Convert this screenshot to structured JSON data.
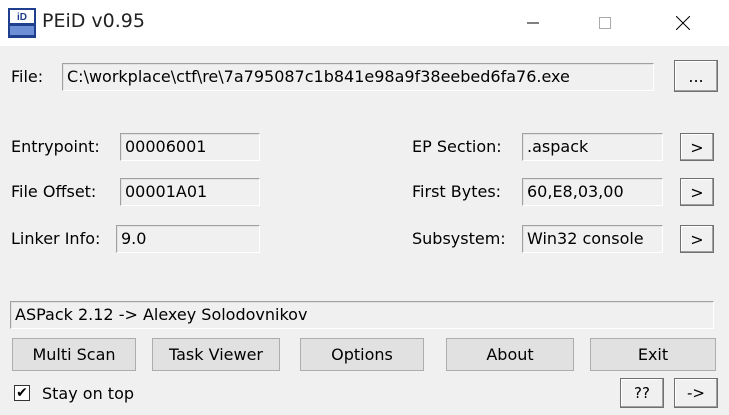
{
  "window": {
    "title": "PEiD v0.95",
    "icon": "peid-app-icon",
    "controls": {
      "minimize": "minimize-icon",
      "maximize": "maximize-icon",
      "close": "close-icon"
    }
  },
  "file": {
    "label": "File:",
    "path": "C:\\workplace\\ctf\\re\\7a795087c1b841e98a9f38eebed6fa76.exe",
    "browse_label": "..."
  },
  "fields": {
    "entrypoint": {
      "label": "Entrypoint:",
      "value": "00006001"
    },
    "file_offset": {
      "label": "File Offset:",
      "value": "00001A01"
    },
    "linker_info": {
      "label": "Linker Info:",
      "value": "9.0"
    },
    "ep_section": {
      "label": "EP Section:",
      "value": ".aspack",
      "button": ">"
    },
    "first_bytes": {
      "label": "First Bytes:",
      "value": "60,E8,03,00",
      "button": ">"
    },
    "subsystem": {
      "label": "Subsystem:",
      "value": "Win32 console",
      "button": ">"
    }
  },
  "result": "ASPack 2.12 -> Alexey Solodovnikov",
  "buttons": {
    "multi_scan": "Multi Scan",
    "task_viewer": "Task Viewer",
    "options": "Options",
    "about": "About",
    "exit": "Exit",
    "help": "??",
    "extra": "->"
  },
  "stay_on_top": {
    "label": "Stay on top",
    "checked": true,
    "mark": "✔"
  }
}
